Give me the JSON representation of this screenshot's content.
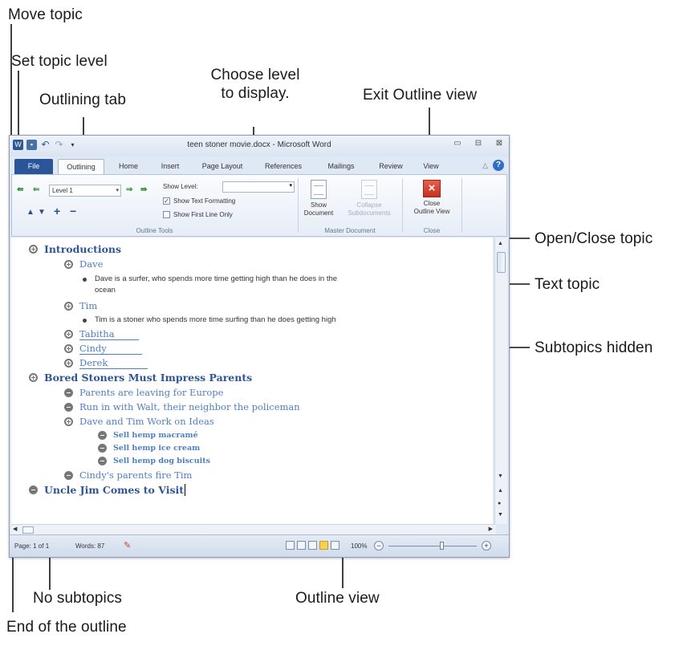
{
  "callouts": {
    "move_topic": "Move topic",
    "set_topic_level": "Set topic level",
    "outlining_tab": "Outlining tab",
    "choose_level_line1": "Choose level",
    "choose_level_line2": "to display.",
    "exit_outline_view": "Exit Outline view",
    "open_close_topic": "Open/Close topic",
    "text_topic": "Text topic",
    "subtopics_hidden": "Subtopics hidden",
    "no_subtopics": "No subtopics",
    "outline_view": "Outline view",
    "end_of_outline": "End of the outline"
  },
  "window": {
    "title": "teen stoner movie.docx - Microsoft Word",
    "qat": {
      "undo": "↶",
      "redo": "↷",
      "dropdown": "▾"
    },
    "controls": {
      "minimize": "▭",
      "maximize": "⊟",
      "close": "⊠"
    },
    "tabs": [
      "File",
      "Outlining",
      "Home",
      "Insert",
      "Page Layout",
      "References",
      "Mailings",
      "Review",
      "View"
    ],
    "help": "?",
    "ribbon_min": "△"
  },
  "ribbon": {
    "level_value": "Level 1",
    "show_level_label": "Show Level:",
    "show_text_formatting": "Show Text Formatting",
    "show_first_line_only": "Show First Line Only",
    "outline_tools_label": "Outline Tools",
    "show_document_line1": "Show",
    "show_document_line2": "Document",
    "collapse_subdocs_line1": "Collapse",
    "collapse_subdocs_line2": "Subdocuments",
    "master_document_label": "Master Document",
    "close_outline_line1": "Close",
    "close_outline_line2": "Outline View",
    "close_group_label": "Close",
    "glyphs": {
      "promote_heading": "⇚",
      "promote": "⇐",
      "demote": "⇒",
      "demote_body": "⇛",
      "move_up": "▲",
      "move_down": "▼",
      "expand": "+",
      "collapse": "−",
      "dropdown": "▾",
      "check": "✓",
      "close_x": "×"
    }
  },
  "outline": {
    "introductions": "Introductions",
    "dave": "Dave",
    "dave_text_1": "Dave is a surfer, who spends more time getting high than he does in the",
    "dave_text_2": "ocean",
    "tim": "Tim",
    "tim_text": "Tim is a stoner who spends more time surfing than he does getting high",
    "tabitha": "Tabitha",
    "cindy": "Cindy",
    "derek": "Derek",
    "bored": "Bored Stoners Must Impress Parents",
    "parents_leaving": "Parents are leaving for Europe",
    "run_in": "Run in with Walt, their neighbor the policeman",
    "dave_tim": "Dave and Tim Work on Ideas",
    "sell1": "Sell hemp macramé",
    "sell2": "Sell hemp ice cream",
    "sell3": "Sell hemp dog biscuits",
    "cindys": "Cindy's parents fire Tim",
    "uncle": "Uncle Jim Comes to Visit"
  },
  "scroll": {
    "up": "▲",
    "down": "▼",
    "left": "◀",
    "right": "▶"
  },
  "status": {
    "page": "Page: 1 of 1",
    "words": "Words: 87",
    "zoom": "100%",
    "zoom_minus": "−",
    "zoom_plus": "+"
  }
}
